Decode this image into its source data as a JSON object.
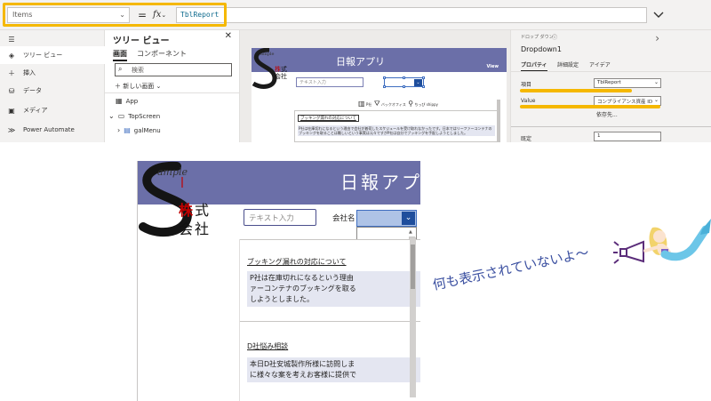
{
  "formula_bar": {
    "property": "Items",
    "equals": "=",
    "fx": "fx",
    "formula": "TblReport"
  },
  "left_rail": {
    "items": [
      {
        "label": "ツリー ビュー",
        "icon": "layers-icon"
      },
      {
        "label": "挿入",
        "icon": "plus-icon"
      },
      {
        "label": "データ",
        "icon": "database-icon"
      },
      {
        "label": "メディア",
        "icon": "media-icon"
      },
      {
        "label": "Power Automate",
        "icon": "power-automate-icon"
      }
    ]
  },
  "tree_view": {
    "title": "ツリー ビュー",
    "tabs": [
      "画面",
      "コンポーネント"
    ],
    "search_placeholder": "検索",
    "new_screen": "新しい画面",
    "nodes": [
      "App",
      "TopScreen",
      "galMenu"
    ]
  },
  "canvas": {
    "app_title": "日報アプリ",
    "view_label": "View",
    "text_input_placeholder": "テキスト入力",
    "header_items": [
      "P社",
      "バックオフィス",
      "ちっぴ shippy"
    ],
    "card_title": "ブッキング漏れの対応について",
    "card_body": "P社は在庫切れになるという理由で会社が着荷したスケジュールを受け取れなかったです。日本ではリーファーコンテナのブッキングを取ることは難しいという事実は元々ですがP社は自分でブッキングを手配しようとしました。"
  },
  "properties": {
    "control_type": "ドロップ ダウン",
    "control_name": "Dropdown1",
    "tabs": [
      "プロパティ",
      "詳細設定",
      "アイデア"
    ],
    "items_label": "項目",
    "items_value": "TblReport",
    "value_label": "Value",
    "value_value": "コンプライアンス資産 ID",
    "dependencies": "依存先...",
    "default_label": "既定",
    "default_value": "1"
  },
  "preview": {
    "app_title": "日報アプリ",
    "logo_text": {
      "ample": "ample",
      "kabu": "株",
      "shiki": "式",
      "kai": "会",
      "sha": "社"
    },
    "text_input_placeholder": "テキスト入力",
    "company_label": "会社名",
    "cards": [
      {
        "title": "ブッキング漏れの対応について",
        "body_lines": [
          "P社は在庫切れになるという理由",
          "ァーコンテナのブッキングを取る",
          "しようとしました。"
        ]
      },
      {
        "title": "D社悩み相談",
        "body_lines": [
          "本日D社安城製作所様に訪問しま",
          "に様々な案を考えお客様に提供で"
        ]
      }
    ]
  },
  "annotation": {
    "text": "何も表示されていないよ～"
  },
  "colors": {
    "highlight": "#f5b800",
    "app_header": "#6b6fa8",
    "dropdown_fill": "#aec3e6",
    "dropdown_chevron": "#1f4e9c",
    "annotation_text": "#3a4fa0"
  }
}
